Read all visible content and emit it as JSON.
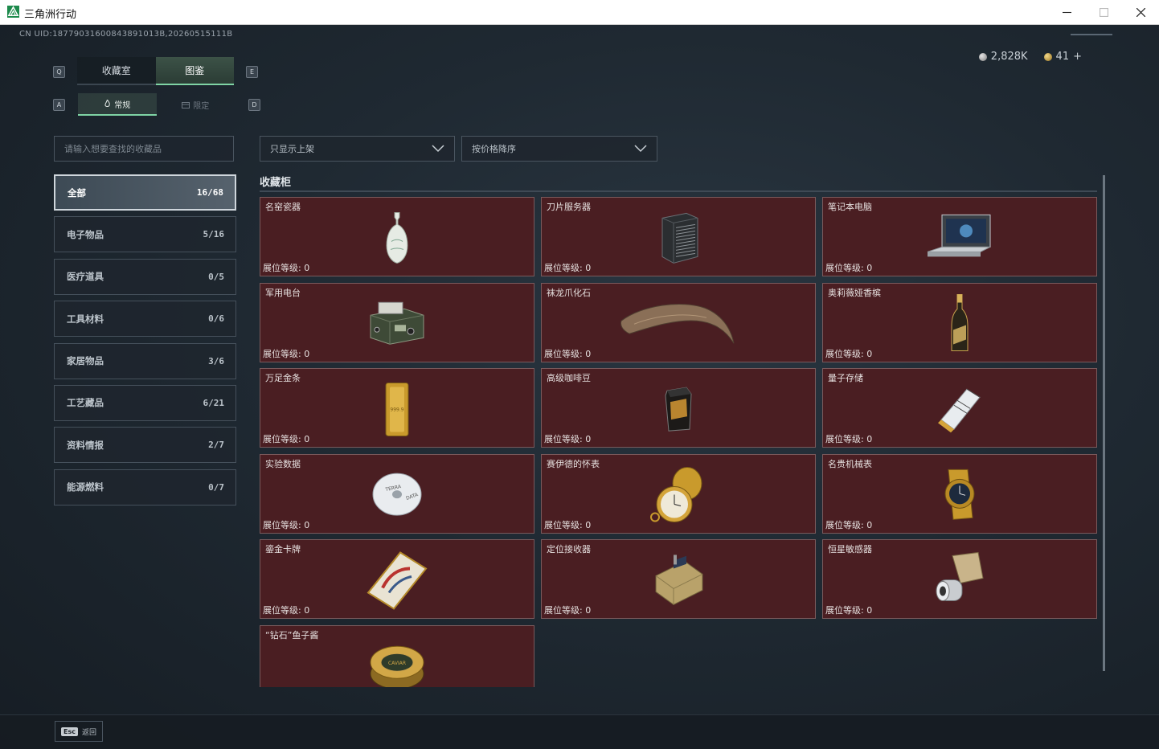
{
  "window": {
    "title": "三角洲行动",
    "controls": [
      "minimize-icon",
      "maximize-icon",
      "close-icon"
    ]
  },
  "header": {
    "uid": "CN UID:18779031600843891013B,20260515111B",
    "currency_silver": "2,828K",
    "currency_gold": "41",
    "add_label": "+"
  },
  "tabs": {
    "key_left": "Q",
    "key_right": "E",
    "items": [
      {
        "label": "收藏室"
      },
      {
        "label": "图鉴"
      }
    ]
  },
  "subtabs": {
    "key_left": "A",
    "key_right": "D",
    "items": [
      {
        "label": "常规"
      },
      {
        "label": "限定"
      }
    ]
  },
  "filters": {
    "search_placeholder": "请输入想要查找的收藏品",
    "listing_filter": "只显示上架",
    "sort_order": "按价格降序"
  },
  "categories": [
    {
      "label": "全部",
      "count": "16/68"
    },
    {
      "label": "电子物品",
      "count": "5/16"
    },
    {
      "label": "医疗道具",
      "count": "0/5"
    },
    {
      "label": "工具材料",
      "count": "0/6"
    },
    {
      "label": "家居物品",
      "count": "3/6"
    },
    {
      "label": "工艺藏品",
      "count": "6/21"
    },
    {
      "label": "资料情报",
      "count": "2/7"
    },
    {
      "label": "能源燃料",
      "count": "0/7"
    }
  ],
  "section": {
    "title": "收藏柜"
  },
  "level_label": "展位等级: 0",
  "items": [
    {
      "name": "名窑瓷器",
      "icon": "porcelain-vase-icon"
    },
    {
      "name": "刀片服务器",
      "icon": "blade-server-icon"
    },
    {
      "name": "笔记本电脑",
      "icon": "laptop-icon"
    },
    {
      "name": "军用电台",
      "icon": "military-radio-icon"
    },
    {
      "name": "袜龙爪化石",
      "icon": "claw-fossil-icon"
    },
    {
      "name": "奥莉薇娅香槟",
      "icon": "champagne-bottle-icon"
    },
    {
      "name": "万足金条",
      "icon": "gold-bar-icon"
    },
    {
      "name": "高级咖啡豆",
      "icon": "coffee-bag-icon"
    },
    {
      "name": "量子存储",
      "icon": "quantum-storage-icon"
    },
    {
      "name": "实验数据",
      "icon": "data-disc-icon"
    },
    {
      "name": "赛伊德的怀表",
      "icon": "pocket-watch-icon"
    },
    {
      "name": "名贵机械表",
      "icon": "wristwatch-icon"
    },
    {
      "name": "鎏金卡牌",
      "icon": "gilded-card-icon"
    },
    {
      "name": "定位接收器",
      "icon": "gps-receiver-icon"
    },
    {
      "name": "恒星敏感器",
      "icon": "star-sensor-icon"
    },
    {
      "name": "“钻石”鱼子酱",
      "icon": "caviar-tin-icon"
    }
  ],
  "footer": {
    "key": "Esc",
    "label": "返回"
  }
}
